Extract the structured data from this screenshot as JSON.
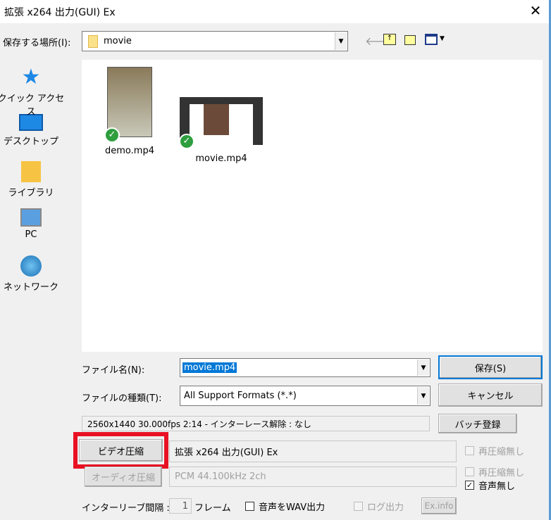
{
  "window": {
    "title": "拡張 x264 出力(GUI) Ex",
    "close": "✕"
  },
  "save_in": {
    "label": "保存する場所(I):",
    "value": "movie"
  },
  "toolbar": {
    "back": "back-icon",
    "up": "folder-up-icon",
    "new_folder": "new-folder-icon",
    "view": "view-menu-icon"
  },
  "places": [
    {
      "label": "クイック アクセス",
      "icon": "star-icon"
    },
    {
      "label": "デスクトップ",
      "icon": "desktop-icon"
    },
    {
      "label": "ライブラリ",
      "icon": "library-icon"
    },
    {
      "label": "PC",
      "icon": "pc-icon"
    },
    {
      "label": "ネットワーク",
      "icon": "network-icon"
    }
  ],
  "files": [
    {
      "name": "demo.mp4"
    },
    {
      "name": "movie.mp4"
    }
  ],
  "filename": {
    "label": "ファイル名(N):",
    "value": "movie.mp4"
  },
  "filetype": {
    "label": "ファイルの種類(T):",
    "value": "All Support Formats (*.*)"
  },
  "buttons": {
    "save": "保存(S)",
    "cancel": "キャンセル",
    "batch": "バッチ登録",
    "video": "ビデオ圧縮",
    "audio": "オーディオ圧縮",
    "exinfo": "Ex.info"
  },
  "info": "2560x1440  30.000fps  2:14  -  インターレース解除 : なし",
  "video_codec": "拡張 x264 出力(GUI) Ex",
  "audio_codec": "PCM 44.100kHz 2ch",
  "checks": {
    "video_norecompress": {
      "label": "再圧縮無し",
      "checked": false
    },
    "audio_norecompress": {
      "label": "再圧縮無し",
      "checked": false
    },
    "no_audio": {
      "label": "音声無し",
      "checked": true
    },
    "wav_out": {
      "label": "音声をWAV出力",
      "checked": false
    },
    "log_out": {
      "label": "ログ出力",
      "checked": false
    }
  },
  "interleave": {
    "label": "インターリーブ間隔 :",
    "value": "1",
    "unit": "フレーム"
  },
  "colors": {
    "highlight": "#e81123",
    "selection": "#0078d7"
  }
}
